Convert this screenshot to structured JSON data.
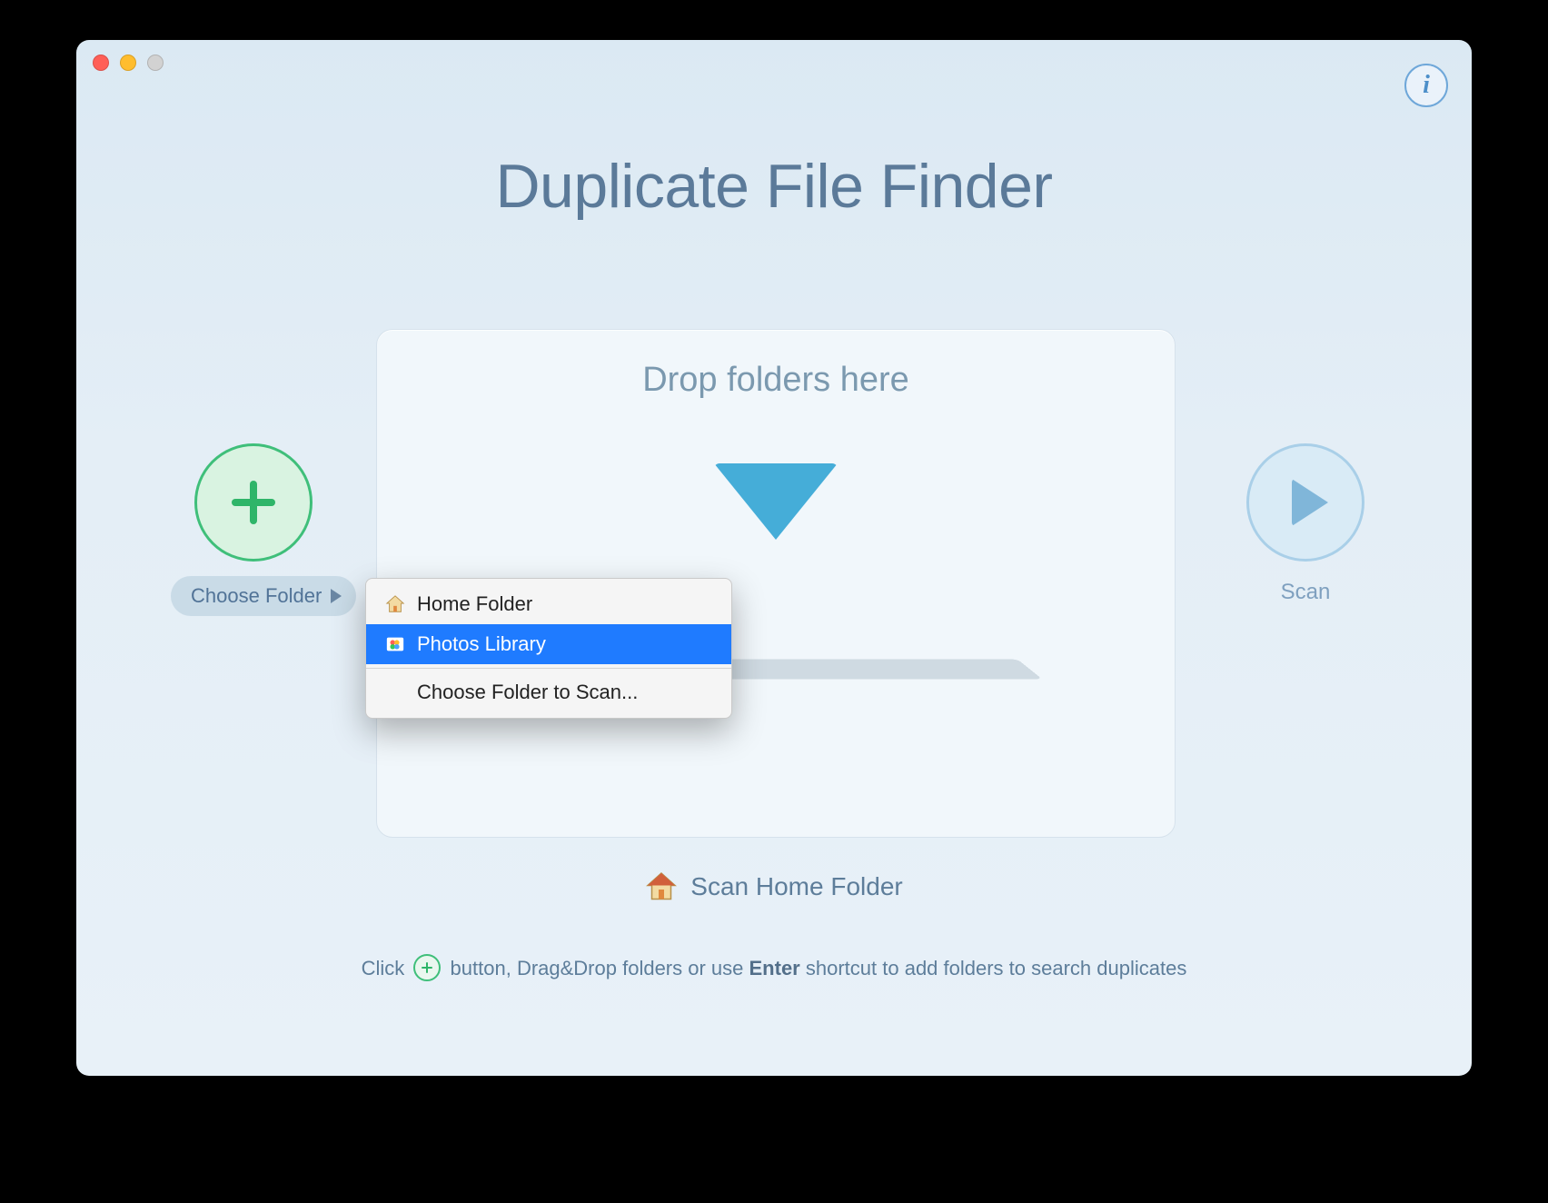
{
  "app": {
    "title": "Duplicate File Finder"
  },
  "drop": {
    "title": "Drop folders here"
  },
  "add": {
    "pill_label": "Choose Folder"
  },
  "scan": {
    "label": "Scan"
  },
  "menu": {
    "items": [
      {
        "label": "Home Folder"
      },
      {
        "label": "Photos Library"
      },
      {
        "label": "Choose Folder to Scan..."
      }
    ]
  },
  "scan_home": {
    "label": "Scan Home Folder"
  },
  "hint": {
    "before": "Click ",
    "mid": " button, Drag&Drop folders or use ",
    "bold": "Enter",
    "after": " shortcut to add folders to search duplicates"
  }
}
